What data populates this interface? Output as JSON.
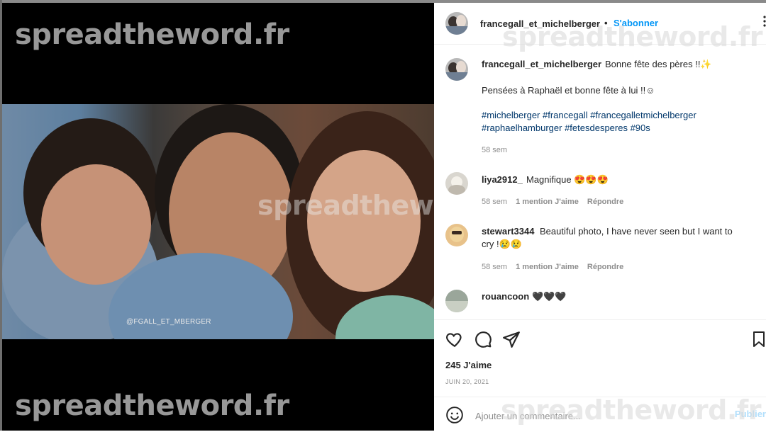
{
  "post": {
    "username": "francegall_et_michelberger",
    "follow_label": "S'abonner",
    "separator": "•",
    "photo_credit": "@FGALL_ET_MBERGER"
  },
  "watermark": {
    "text": "spreadtheword.fr"
  },
  "caption": {
    "username": "francegall_et_michelberger",
    "line1": "Bonne fête des pères !!✨",
    "line2": "Pensées à Raphaël et bonne fête à lui !!☺",
    "tags_line1": "#michelberger #francegall #francegalletmichelberger",
    "tags_line2": "#raphaelhamburger #fetesdesperes #90s",
    "time": "58 sem"
  },
  "comments": [
    {
      "username": "liya2912_",
      "text": "Magnifique 😍😍😍",
      "time": "58 sem",
      "likes": "1 mention J'aime",
      "reply": "Répondre"
    },
    {
      "username": "stewart3344",
      "text": "Beautiful photo, I have never seen but I want to",
      "text2": "cry !😢😢",
      "time": "58 sem",
      "likes": "1 mention J'aime",
      "reply": "Répondre"
    },
    {
      "username": "rouancoon",
      "text": "🖤🖤🖤"
    }
  ],
  "actions": {
    "likes_count": "245 J'aime",
    "date": "JUIN 20, 2021",
    "comment_placeholder": "Ajouter un commentaire...",
    "publish_label": "Publier"
  },
  "colors": {
    "accent": "#0095f6",
    "hashtag": "#00376b",
    "secondary_text": "#8e8e8e"
  }
}
